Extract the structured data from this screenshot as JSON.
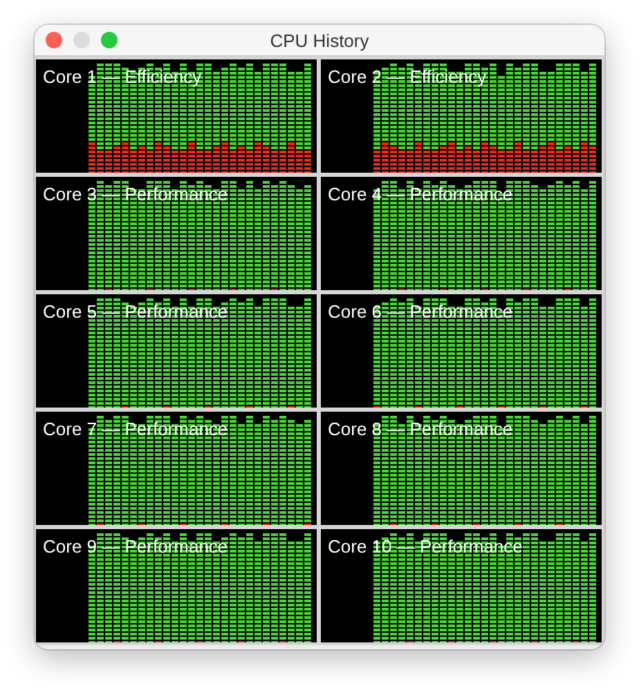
{
  "window": {
    "title": "CPU History"
  },
  "cores": [
    {
      "label": "Core 1 — Efficiency",
      "kind": "efficiency"
    },
    {
      "label": "Core 2 — Efficiency",
      "kind": "efficiency"
    },
    {
      "label": "Core 3 — Performance",
      "kind": "performance"
    },
    {
      "label": "Core 4 — Performance",
      "kind": "performance"
    },
    {
      "label": "Core 5 — Performance",
      "kind": "performance"
    },
    {
      "label": "Core 6 — Performance",
      "kind": "performance"
    },
    {
      "label": "Core 7 — Performance",
      "kind": "performance"
    },
    {
      "label": "Core 8 — Performance",
      "kind": "performance"
    },
    {
      "label": "Core 9 — Performance",
      "kind": "performance"
    },
    {
      "label": "Core 10 — Performance",
      "kind": "performance"
    }
  ]
}
